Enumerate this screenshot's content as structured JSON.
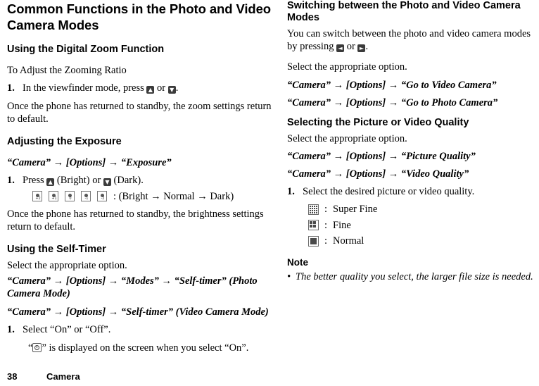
{
  "left": {
    "title": "Common Functions in the Photo and Video Camera Modes",
    "section1": {
      "heading": "Using the Digital Zoom Function",
      "subheading": "To Adjust the Zooming Ratio",
      "step1": {
        "num": "1.",
        "text_before": "In the viewfinder mode, press ",
        "key_up": "▲",
        "text_mid": " or ",
        "key_down": "▼",
        "text_after": "."
      },
      "paragraph": "Once the phone has returned to standby, the zoom settings return to default."
    },
    "section2": {
      "heading": "Adjusting the Exposure",
      "path": "“Camera” → [Options] → “Exposure”",
      "step1": {
        "num": "1.",
        "text_before": "Press ",
        "key_up": "▲",
        "text_mid": " (Bright) or ",
        "key_down": "▼",
        "text_after": " (Dark)."
      },
      "icon_row_labels": [
        "+2",
        "+1",
        "0",
        "-1",
        "-2"
      ],
      "icon_row_text": ": (Bright → Normal → Dark)",
      "paragraph": "Once the phone has returned to standby, the brightness settings return to default."
    },
    "section3": {
      "heading": "Using the Self-Timer",
      "paragraph": "Select the appropriate option.",
      "path1": "“Camera” → [Options] → “Modes” → “Self-timer” (Photo Camera Mode)",
      "path2": "“Camera” → [Options] → “Self-timer” (Video Camera Mode)",
      "step1": {
        "num": "1.",
        "text": "Select “On” or “Off”."
      },
      "note_before": "“",
      "note_after": "” is displayed on the screen when you select “On”."
    }
  },
  "right": {
    "section1": {
      "heading": "Switching between the Photo and Video Camera Modes",
      "paragraph_before": "You can switch between the photo and video camera modes by pressing ",
      "key_left": "◄",
      "paragraph_mid": " or ",
      "key_right": "►",
      "paragraph_after": ".",
      "paragraph2": "Select the appropriate option.",
      "path1": "“Camera” → [Options] → “Go to Video Camera”",
      "path2": "“Camera” → [Options] → “Go to Photo Camera”"
    },
    "section2": {
      "heading": "Selecting the Picture or Video Quality",
      "paragraph": "Select the appropriate option.",
      "path1": "“Camera” → [Options] → “Picture Quality”",
      "path2": "“Camera” → [Options] → “Video Quality”",
      "step1": {
        "num": "1.",
        "text": "Select the desired picture or video quality."
      },
      "quality_items": [
        {
          "sep": ":",
          "label": "Super Fine"
        },
        {
          "sep": ":",
          "label": "Fine"
        },
        {
          "sep": ":",
          "label": "Normal"
        }
      ]
    },
    "note": {
      "heading": "Note",
      "bullet": "•",
      "text": "The better quality you select, the larger file size is needed."
    }
  },
  "footer": {
    "page_number": "38",
    "chapter": "Camera"
  }
}
